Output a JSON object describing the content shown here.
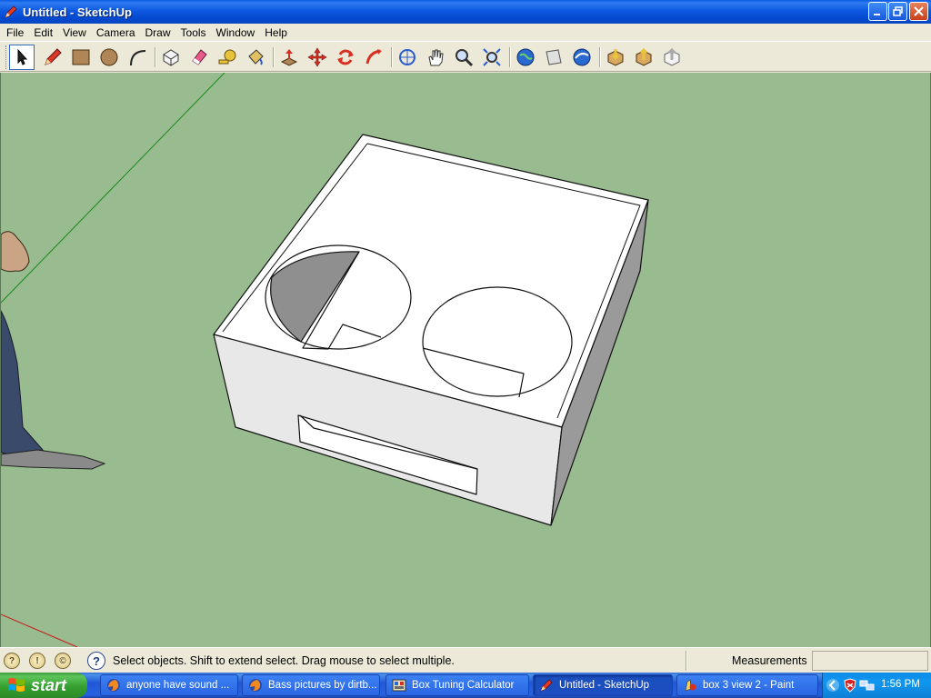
{
  "window": {
    "title": "Untitled - SketchUp"
  },
  "menu": {
    "items": [
      "File",
      "Edit",
      "View",
      "Camera",
      "Draw",
      "Tools",
      "Window",
      "Help"
    ]
  },
  "toolbar": {
    "tools": [
      "select-tool-icon",
      "pencil-tool-icon",
      "rectangle-tool-icon",
      "circle-tool-icon",
      "arc-tool-icon",
      "make-component-icon",
      "eraser-icon",
      "tape-measure-icon",
      "paint-bucket-icon",
      "push-pull-icon",
      "move-icon",
      "rotate-icon",
      "follow-me-icon",
      "orbit-icon",
      "pan-icon",
      "zoom-icon",
      "zoom-extents-icon",
      "google-earth-toggle-icon",
      "get-current-view-icon",
      "preview-google-earth-icon",
      "get-models-icon",
      "share-model-icon",
      "share-component-icon"
    ]
  },
  "status": {
    "hint": "Select objects. Shift to extend select. Drag mouse to select multiple.",
    "measurements_label": "Measurements",
    "measurements_value": ""
  },
  "taskbar": {
    "start_label": "start",
    "tasks": [
      {
        "label": "anyone have sound ...",
        "icon": "firefox-icon"
      },
      {
        "label": "Bass pictures by dirtb...",
        "icon": "firefox-icon"
      },
      {
        "label": "Box Tuning Calculator",
        "icon": "calculator-app-icon"
      },
      {
        "label": "Untitled - SketchUp",
        "icon": "sketchup-icon"
      },
      {
        "label": "box 3 view 2 - Paint",
        "icon": "paint-icon"
      }
    ],
    "clock": "1:56 PM"
  },
  "colors": {
    "viewport_bg": "#98bb8f",
    "titlebar": "#0a5ae6",
    "taskbar": "#2663e0",
    "start": "#35a030"
  }
}
